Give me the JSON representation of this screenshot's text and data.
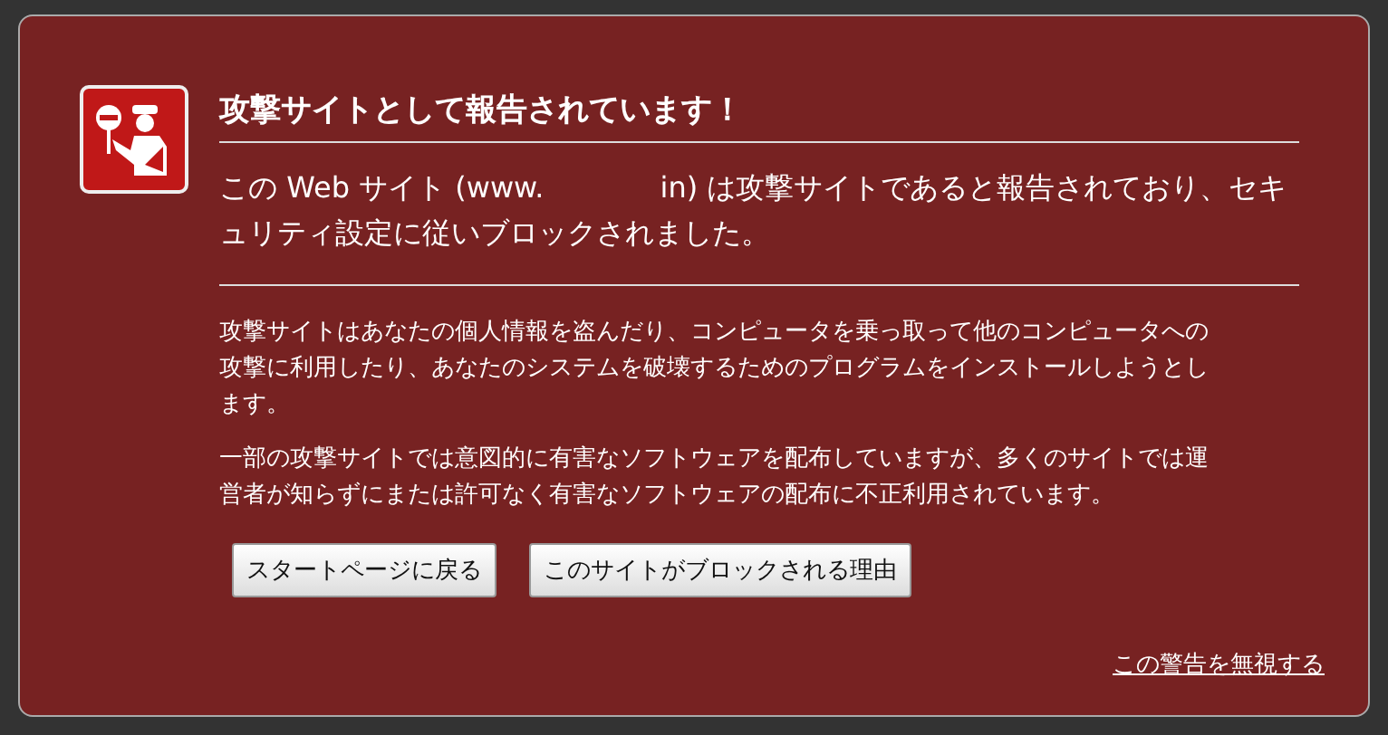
{
  "title": "攻撃サイトとして報告されています！",
  "intro": "この Web サイト (www.　　　　in) は攻撃サイトであると報告されており、セキュリティ設定に従いブロックされました。",
  "paragraphs": [
    "攻撃サイトはあなたの個人情報を盗んだり、コンピュータを乗っ取って他のコンピュータへの攻撃に利用したり、あなたのシステムを破壊するためのプログラムをインストールしようとします。",
    "一部の攻撃サイトでは意図的に有害なソフトウェアを配布していますが、多くのサイトでは運営者が知らずにまたは許可なく有害なソフトウェアの配布に不正利用されています。"
  ],
  "buttons": [
    "スタートページに戻る",
    "このサイトがブロックされる理由"
  ],
  "ignore_link": "この警告を無視する"
}
